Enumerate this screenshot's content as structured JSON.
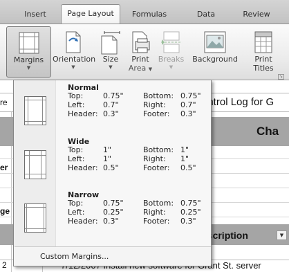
{
  "tabs": [
    "Insert",
    "Page Layout",
    "Formulas",
    "Data",
    "Review"
  ],
  "ribbon": {
    "margins_label": "Margins",
    "orientation_label": "Orientation",
    "size_label": "Size",
    "print_area_label_1": "Print",
    "print_area_label_2": "Area",
    "breaks_label": "Breaks",
    "background_label": "Background",
    "print_titles_label_1": "Print",
    "print_titles_label_2": "Titles"
  },
  "sheet": {
    "formula_fragment": "ontrol Log for G",
    "title_fragment": "Cha",
    "left_frag_1": "er",
    "left_frag_2": "ge",
    "header_fragment": "escription",
    "row_number": "2",
    "bottom_row_text": "7/12/2007 Install new software for Grant St. server"
  },
  "margins_menu": {
    "options": [
      {
        "name": "Normal",
        "top_label": "Top:",
        "top": "0.75\"",
        "bottom_label": "Bottom:",
        "bottom": "0.75\"",
        "left_label": "Left:",
        "left": "0.7\"",
        "right_label": "Right:",
        "right": "0.7\"",
        "header_label": "Header:",
        "header": "0.3\"",
        "footer_label": "Footer:",
        "footer": "0.3\""
      },
      {
        "name": "Wide",
        "top_label": "Top:",
        "top": "1\"",
        "bottom_label": "Bottom:",
        "bottom": "1\"",
        "left_label": "Left:",
        "left": "1\"",
        "right_label": "Right:",
        "right": "1\"",
        "header_label": "Header:",
        "header": "0.5\"",
        "footer_label": "Footer:",
        "footer": "0.5\""
      },
      {
        "name": "Narrow",
        "top_label": "Top:",
        "top": "0.75\"",
        "bottom_label": "Bottom:",
        "bottom": "0.75\"",
        "left_label": "Left:",
        "left": "0.25\"",
        "right_label": "Right:",
        "right": "0.25\"",
        "header_label": "Header:",
        "header": "0.3\"",
        "footer_label": "Footer:",
        "footer": "0.3\""
      }
    ],
    "custom_label": "Custom Margins..."
  }
}
